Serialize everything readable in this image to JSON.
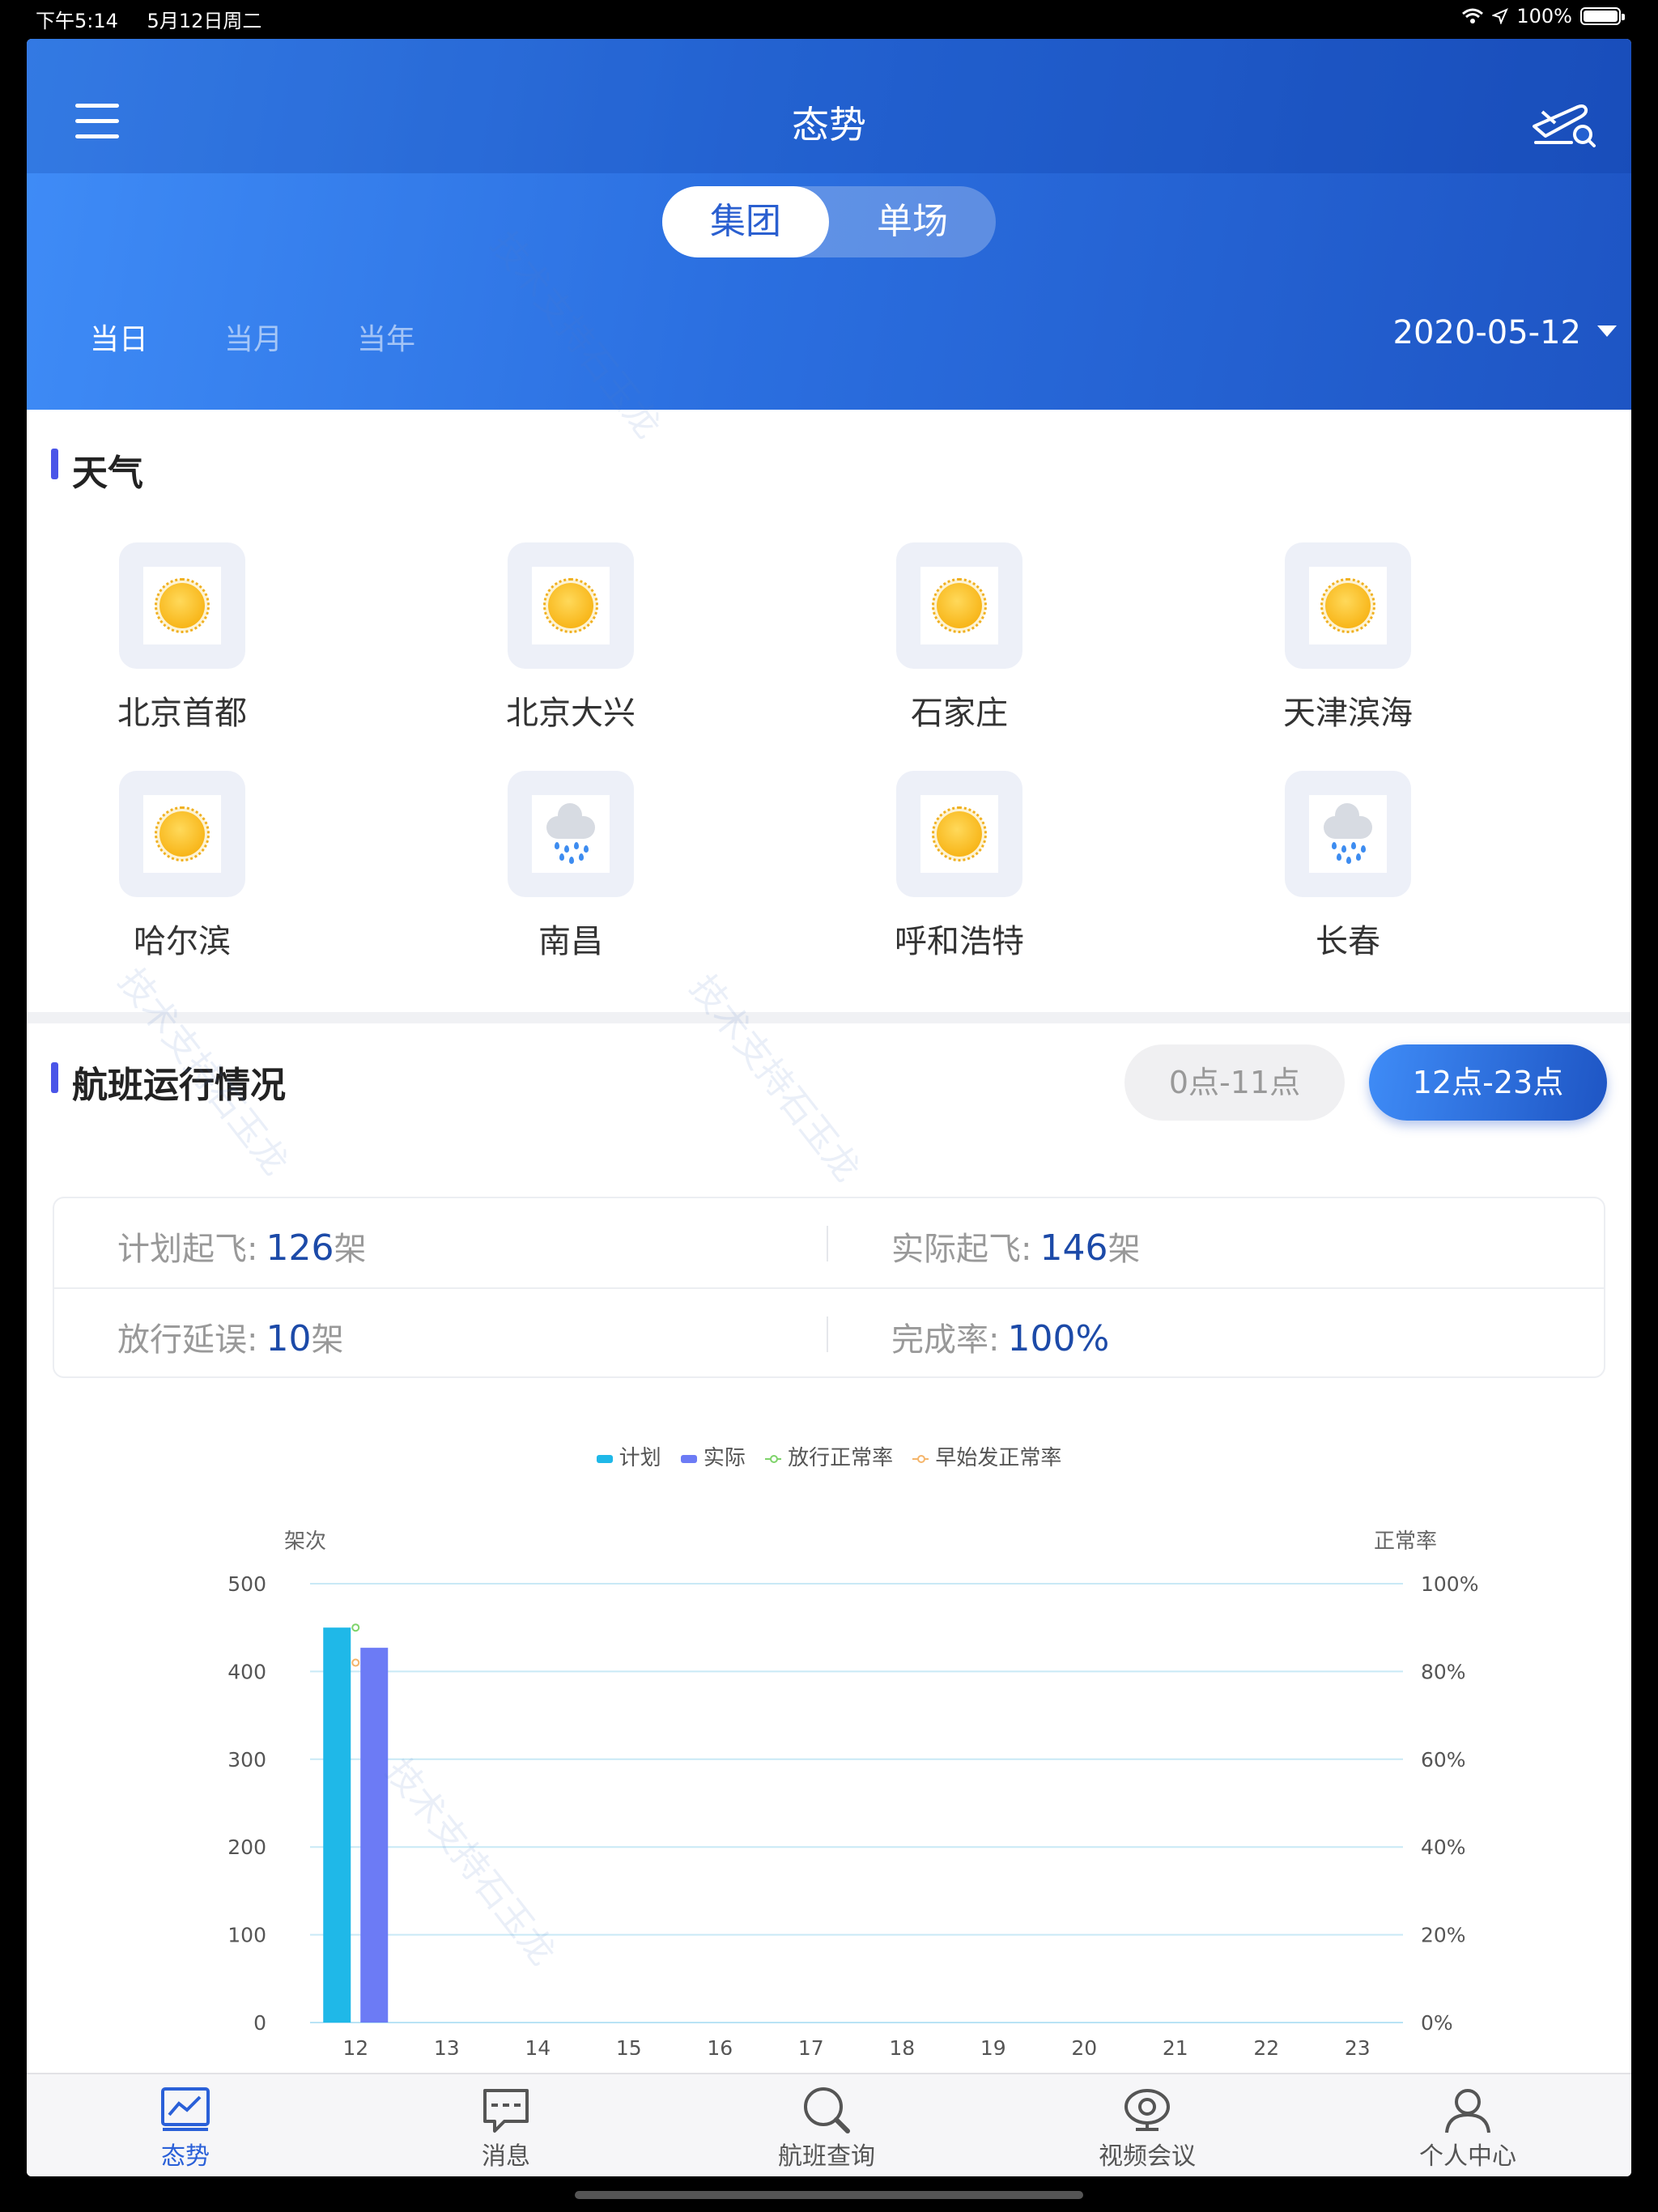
{
  "status_bar": {
    "time": "下午5:14",
    "date": "5月12日周二",
    "battery": "100%"
  },
  "header": {
    "title": "态势",
    "segments": [
      "集团",
      "单场"
    ],
    "active_segment": "集团",
    "periods": [
      "当日",
      "当月",
      "当年"
    ],
    "active_period": "当日",
    "date": "2020-05-12"
  },
  "weather": {
    "title": "天气",
    "items": [
      {
        "name": "北京首都",
        "icon": "sunny-icon"
      },
      {
        "name": "北京大兴",
        "icon": "sunny-icon"
      },
      {
        "name": "石家庄",
        "icon": "sunny-icon"
      },
      {
        "name": "天津滨海",
        "icon": "sunny-icon"
      },
      {
        "name": "哈尔滨",
        "icon": "sunny-icon"
      },
      {
        "name": "南昌",
        "icon": "rain-icon"
      },
      {
        "name": "呼和浩特",
        "icon": "sunny-icon"
      },
      {
        "name": "长春",
        "icon": "rain-icon"
      }
    ]
  },
  "flights": {
    "title": "航班运行情况",
    "ranges": [
      "0点-11点",
      "12点-23点"
    ],
    "active_range": "12点-23点",
    "stats": {
      "planned": {
        "label": "计划起飞:",
        "value": "126",
        "unit": "架"
      },
      "actual": {
        "label": "实际起飞:",
        "value": "146",
        "unit": "架"
      },
      "delay": {
        "label": "放行延误:",
        "value": "10",
        "unit": "架"
      },
      "completion": {
        "label": "完成率:",
        "value": "100%",
        "unit": ""
      }
    }
  },
  "chart_data": {
    "type": "bar",
    "categories": [
      "12",
      "13",
      "14",
      "15",
      "16",
      "17",
      "18",
      "19",
      "20",
      "21",
      "22",
      "23"
    ],
    "series": [
      {
        "name": "计划",
        "type": "bar",
        "values": [
          450,
          null,
          null,
          null,
          null,
          null,
          null,
          null,
          null,
          null,
          null,
          null
        ],
        "color": "#1fb8e8"
      },
      {
        "name": "实际",
        "type": "bar",
        "values": [
          427,
          null,
          null,
          null,
          null,
          null,
          null,
          null,
          null,
          null,
          null,
          null
        ],
        "color": "#6c7bf5"
      },
      {
        "name": "放行正常率",
        "type": "line",
        "axis": "right",
        "values": [
          90,
          null,
          null,
          null,
          null,
          null,
          null,
          null,
          null,
          null,
          null,
          null
        ],
        "color": "#7ed36a"
      },
      {
        "name": "早始发正常率",
        "type": "line",
        "axis": "right",
        "values": [
          82,
          null,
          null,
          null,
          null,
          null,
          null,
          null,
          null,
          null,
          null,
          null
        ],
        "color": "#f5b56b"
      }
    ],
    "ylabel": "架次",
    "ylabel_right": "正常率",
    "ylim": [
      0,
      500
    ],
    "yticks": [
      "0",
      "100",
      "200",
      "300",
      "400",
      "500"
    ],
    "ylim_right": [
      0,
      100
    ],
    "yticks_right": [
      "0%",
      "20%",
      "40%",
      "60%",
      "80%",
      "100%"
    ],
    "grid": true,
    "legend_position": "top-center"
  },
  "tabbar": {
    "items": [
      {
        "label": "态势",
        "icon": "monitor-chart-icon"
      },
      {
        "label": "消息",
        "icon": "message-icon"
      },
      {
        "label": "航班查询",
        "icon": "search-icon"
      },
      {
        "label": "视频会议",
        "icon": "webcam-icon"
      },
      {
        "label": "个人中心",
        "icon": "user-icon"
      }
    ],
    "active": "态势"
  },
  "watermark": "技术支持石玉龙",
  "colors": {
    "accent": "#2a60d8",
    "header_start": "#3f8cf7",
    "header_end": "#1e55c4",
    "stat_value": "#1c4aa8"
  }
}
